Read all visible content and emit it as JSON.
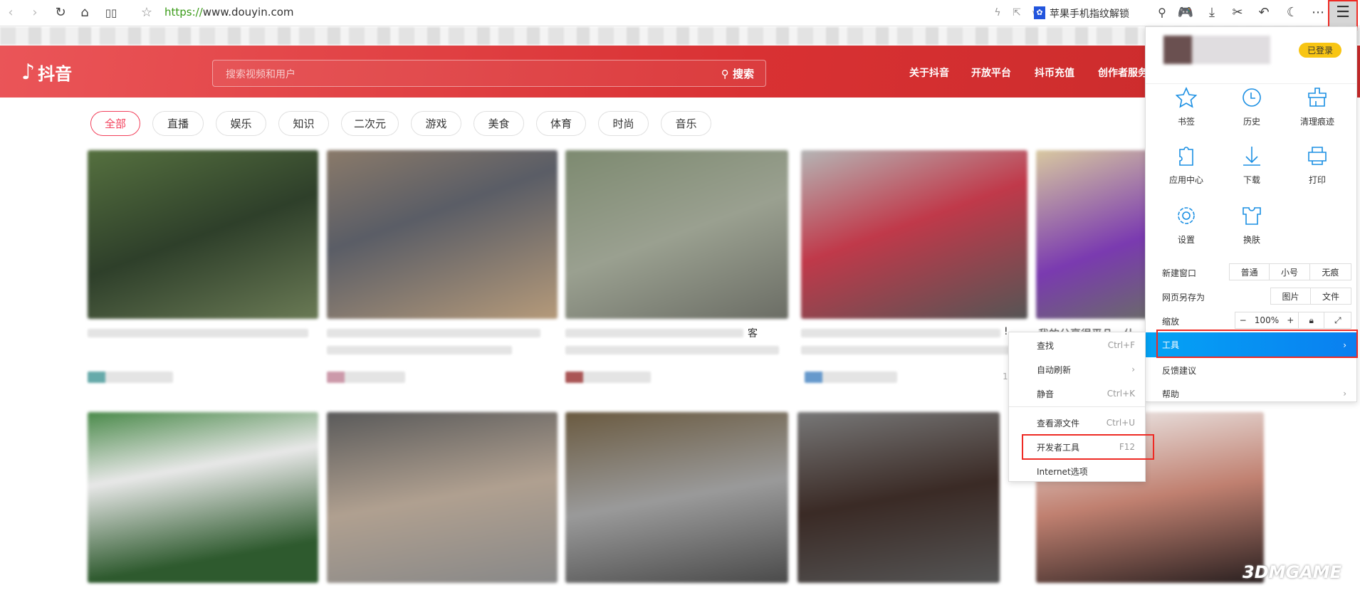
{
  "toolbar": {
    "url_scheme": "https://",
    "url_host": "www.douyin.com",
    "search_suggestion": "苹果手机指纹解锁",
    "icons": [
      "back-icon",
      "forward-icon",
      "reload-icon",
      "home-icon",
      "reader-icon",
      "star-icon",
      "lightning-icon",
      "share-icon",
      "chevron-down-icon",
      "baidu-paw-icon",
      "search-icon",
      "game-icon",
      "download-icon",
      "scissors-icon",
      "undo-icon",
      "moon-icon",
      "more-icon",
      "hamburger-menu-icon"
    ]
  },
  "header": {
    "logo": "抖音",
    "search_placeholder": "搜索视频和用户",
    "search_button": "搜索",
    "nav": [
      "关于抖音",
      "开放平台",
      "抖币充值",
      "创作者服务"
    ],
    "brand_color": "#e03436"
  },
  "categories": [
    "全部",
    "直播",
    "娱乐",
    "知识",
    "二次元",
    "游戏",
    "美食",
    "体育",
    "时尚",
    "音乐"
  ],
  "card_partial_texts": [
    "客",
    "!",
    "我的分享很平凡，什",
    "1"
  ],
  "menu": {
    "login_badge": "已登录",
    "grid": [
      "书签",
      "历史",
      "清理痕迹",
      "应用中心",
      "下载",
      "打印",
      "设置",
      "换肤"
    ],
    "new_window": {
      "label": "新建窗口",
      "options": [
        "普通",
        "小号",
        "无痕"
      ]
    },
    "save_as": {
      "label": "网页另存为",
      "options": [
        "图片",
        "文件"
      ]
    },
    "zoom": {
      "label": "缩放",
      "minus": "−",
      "value": "100%",
      "plus": "+"
    },
    "items": [
      "工具",
      "反馈建议",
      "帮助"
    ],
    "accent": "#0a94f0"
  },
  "submenu": {
    "items": [
      {
        "label": "查找",
        "key": "Ctrl+F"
      },
      {
        "label": "自动刷新",
        "key": "›"
      },
      {
        "label": "静音",
        "key": "Ctrl+K"
      },
      {
        "label": "查看源文件",
        "key": "Ctrl+U"
      },
      {
        "label": "开发者工具",
        "key": "F12"
      },
      {
        "label": "Internet选项",
        "key": ""
      }
    ]
  },
  "watermark": "3DMGAME"
}
